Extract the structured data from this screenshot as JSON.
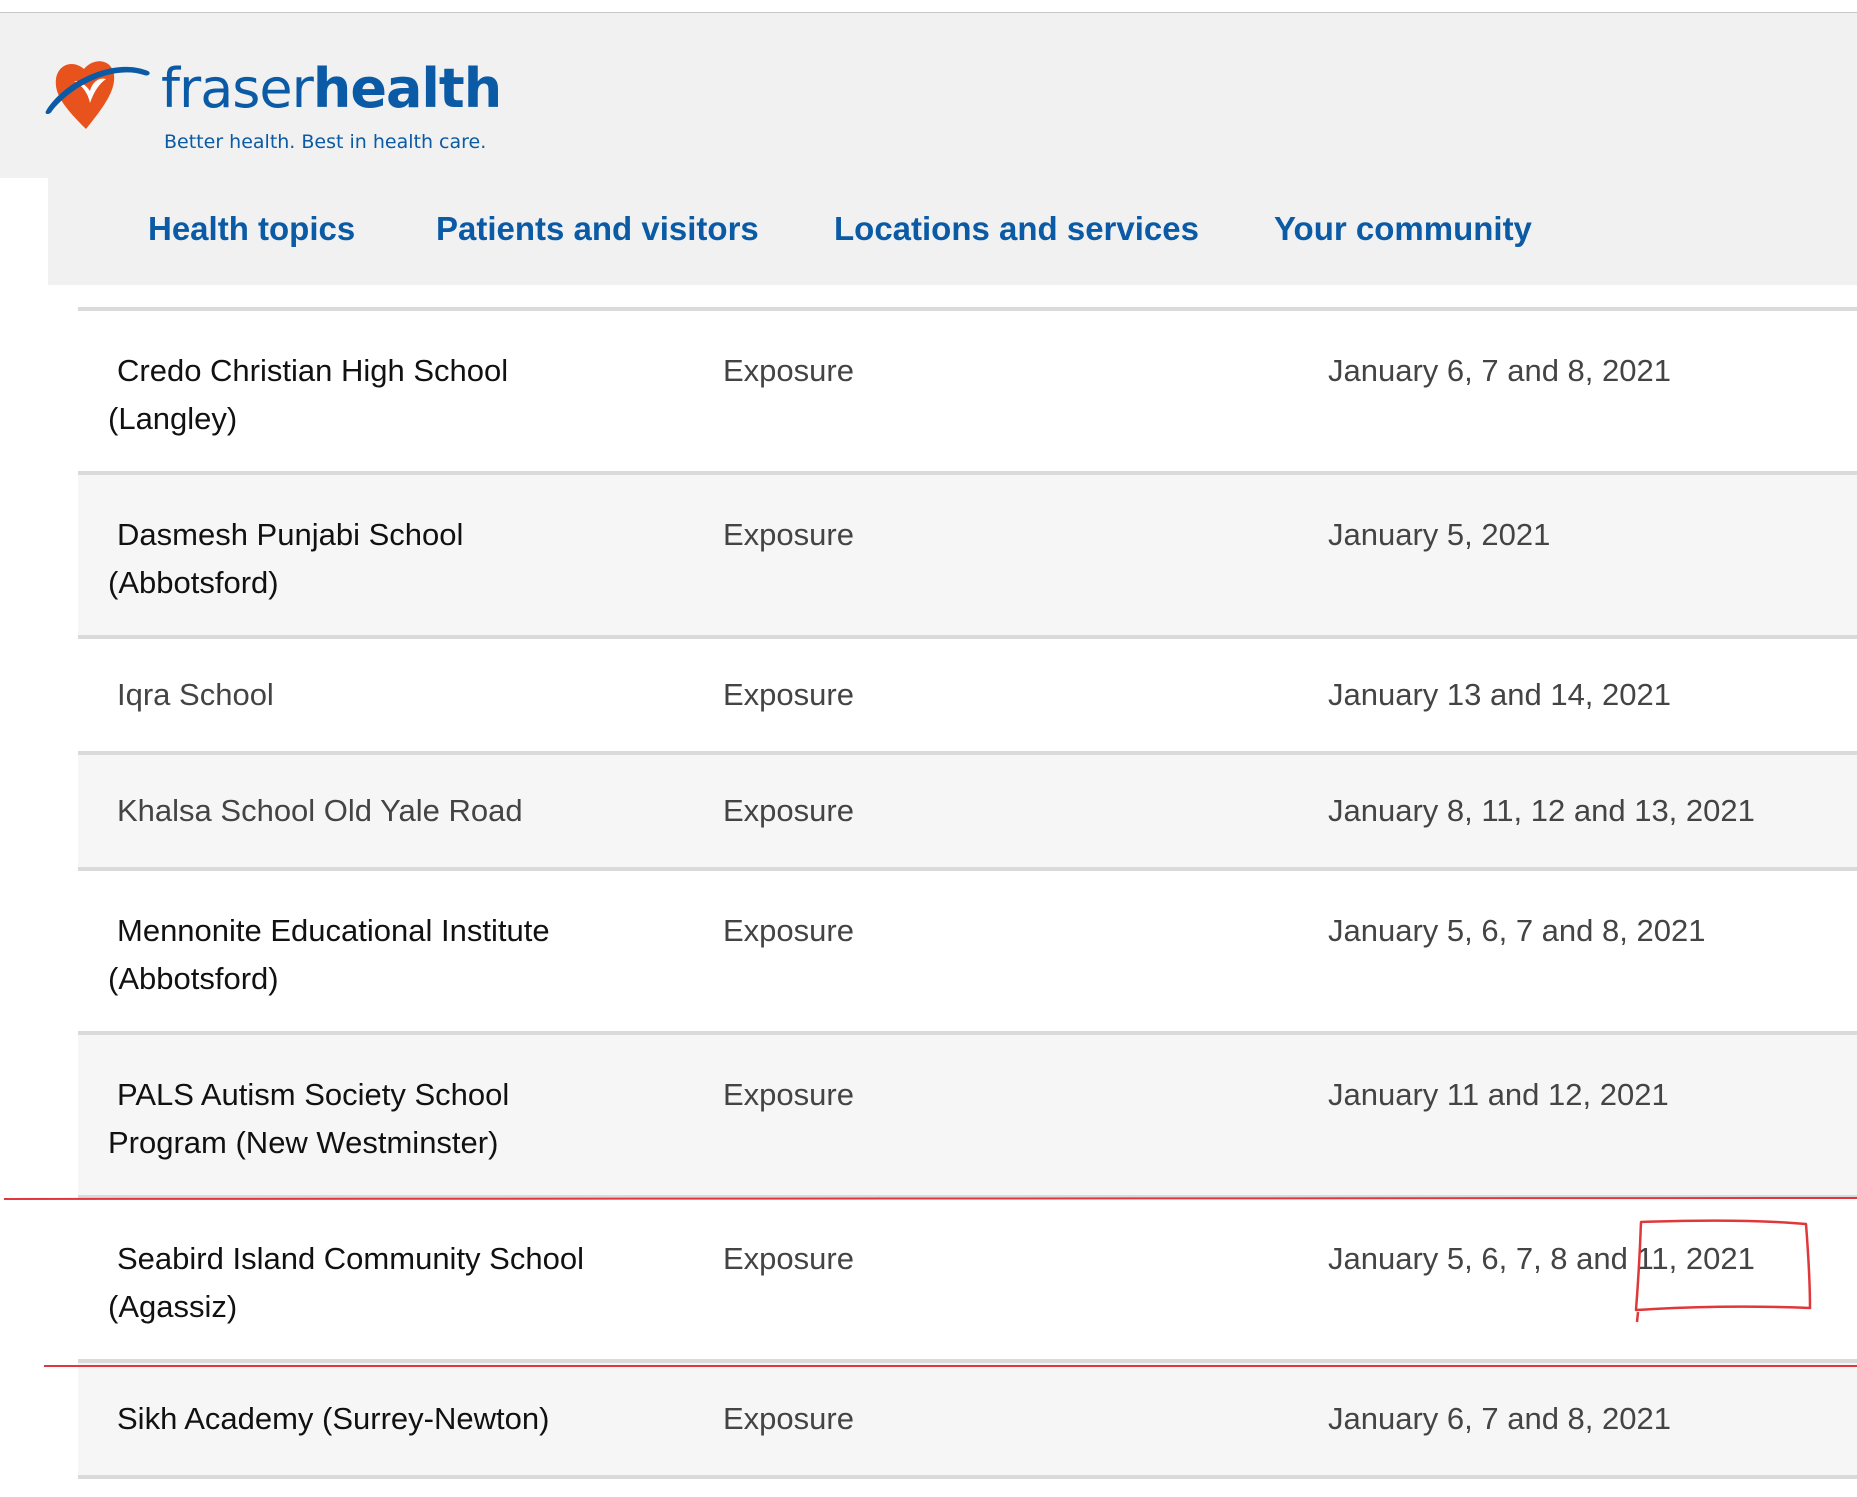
{
  "brand": {
    "name_regular": "fraser",
    "name_bold": "health",
    "tagline": "Better health. Best in health care.",
    "colors": {
      "blue": "#0a5aa5",
      "orange": "#e8531d"
    }
  },
  "nav": {
    "items": [
      {
        "label": "Health topics"
      },
      {
        "label": "Patients and visitors"
      },
      {
        "label": "Locations and services"
      },
      {
        "label": "Your community"
      }
    ]
  },
  "rows": [
    {
      "name_line1": "Credo Christian High School",
      "name_line2": "(Langley)",
      "status": "Exposure",
      "dates": "January 6, 7 and 8, 2021"
    },
    {
      "name_line1": "Dasmesh Punjabi School",
      "name_line2": "(Abbotsford)",
      "status": "Exposure",
      "dates": "January 5, 2021"
    },
    {
      "name_line1": "Iqra School",
      "name_line2": "",
      "status": "Exposure",
      "dates": "January 13 and 14, 2021"
    },
    {
      "name_line1": "Khalsa School Old Yale Road",
      "name_line2": "",
      "status": "Exposure",
      "dates": "January 8, 11, 12 and 13, 2021"
    },
    {
      "name_line1": "Mennonite Educational Institute",
      "name_line2": "(Abbotsford)",
      "status": "Exposure",
      "dates": "January 5, 6, 7 and 8, 2021"
    },
    {
      "name_line1": "PALS Autism Society School",
      "name_line2": "Program (New Westminster)",
      "status": "Exposure",
      "dates": "January 11 and 12, 2021"
    },
    {
      "name_line1": "Seabird Island Community School",
      "name_line2": "(Agassiz)",
      "status": "Exposure",
      "dates": "January 5, 6, 7, 8 and 11, 2021"
    },
    {
      "name_line1": "Sikh Academy (Surrey-Newton)",
      "name_line2": "",
      "status": "Exposure",
      "dates": "January 6, 7 and 8, 2021"
    }
  ],
  "annotation": {
    "color": "#e0383a"
  }
}
